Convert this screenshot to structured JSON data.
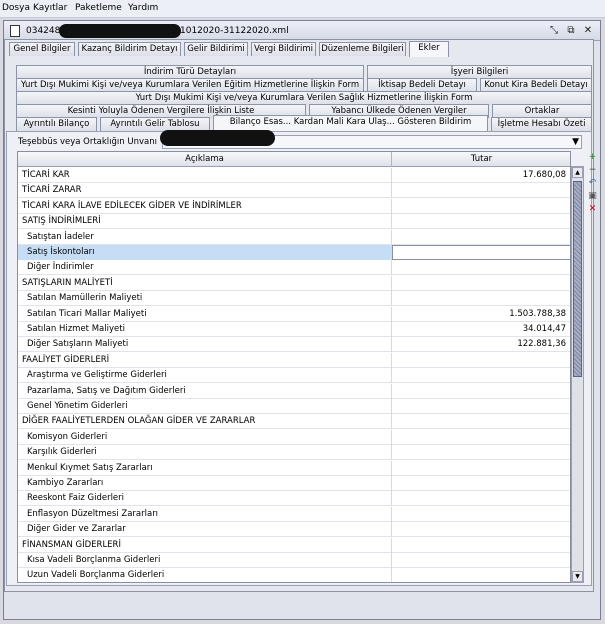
{
  "menu": [
    "Dosya",
    "Kayıtlar",
    "Paketleme",
    "Yardım"
  ],
  "window": {
    "title_prefix": "034248",
    "title_suffix": "1012020-31122020.xml",
    "btn_restore": "⤡",
    "btn_maximize": "⧉",
    "btn_close": "✕"
  },
  "tabs_top": [
    "Genel Bilgiler",
    "Kazanç Bildirim Detayı",
    "Gelir Bildirimi",
    "Vergi Bildirimi",
    "Düzenleme Bilgileri",
    "Ekler"
  ],
  "ek_tabs": {
    "row1": [
      "İndirim Türü Detayları",
      "İşyeri Bilgileri"
    ],
    "row2": [
      "Yurt Dışı Mukimi Kişi ve/veya Kurumlara Verilen Eğitim Hizmetlerine İlişkin Form",
      "İktisap Bedeli Detayı",
      "Konut Kira Bedeli Detayı"
    ],
    "row3": [
      "Yurt Dışı Mukimi Kişi ve/veya Kurumlara Verilen Sağlık Hizmetlerine İlişkin Form"
    ],
    "row4": [
      "Kesinti Yoluyla Ödenen Vergilere İlişkin Liste",
      "Yabancı Ülkede Ödenen Vergiler",
      "Ortaklar"
    ],
    "row5": [
      "Ayrıntılı Bilanço",
      "Ayrıntılı Gelir Tablosu",
      "Bilanço Esas... Kardan Mali Kara Ulaş... Gösteren Bildirim",
      "İşletme Hesabı Özeti"
    ]
  },
  "firm": {
    "label": "Teşebbüs veya Ortaklığın Unvanı",
    "dropdown_icon": "▼"
  },
  "grid": {
    "headers": [
      "Açıklama",
      "Tutar"
    ],
    "rows": [
      {
        "label": "TİCARİ KAR",
        "value": "17.680,08",
        "indent": false
      },
      {
        "label": "TİCARİ ZARAR",
        "value": "",
        "indent": false
      },
      {
        "label": "TİCARİ KARA İLAVE EDİLECEK GİDER VE İNDİRİMLER",
        "value": "",
        "indent": false
      },
      {
        "label": "SATIŞ İNDİRİMLERİ",
        "value": "",
        "indent": false
      },
      {
        "label": "Satıştan İadeler",
        "value": "",
        "indent": true
      },
      {
        "label": "Satış İskontoları",
        "value": "",
        "indent": true,
        "selected": true
      },
      {
        "label": "Diğer İndirimler",
        "value": "",
        "indent": true
      },
      {
        "label": "SATIŞLARIN MALİYETİ",
        "value": "",
        "indent": false
      },
      {
        "label": "Satılan Mamüllerin Maliyeti",
        "value": "",
        "indent": true
      },
      {
        "label": "Satılan Ticari Mallar Maliyeti",
        "value": "1.503.788,38",
        "indent": true
      },
      {
        "label": "Satılan Hizmet Maliyeti",
        "value": "34.014,47",
        "indent": true
      },
      {
        "label": "Diğer Satışların Maliyeti",
        "value": "122.881,36",
        "indent": true
      },
      {
        "label": "FAALİYET GİDERLERİ",
        "value": "",
        "indent": false
      },
      {
        "label": "Araştırma ve Geliştirme Giderleri",
        "value": "",
        "indent": true
      },
      {
        "label": "Pazarlama, Satış ve Dağıtım Giderleri",
        "value": "",
        "indent": true
      },
      {
        "label": "Genel Yönetim Giderleri",
        "value": "",
        "indent": true
      },
      {
        "label": "DİĞER FAALİYETLERDEN OLAĞAN GİDER VE ZARARLAR",
        "value": "",
        "indent": false
      },
      {
        "label": "Komisyon Giderleri",
        "value": "",
        "indent": true
      },
      {
        "label": "Karşılık Giderleri",
        "value": "",
        "indent": true
      },
      {
        "label": "Menkul Kıymet Satış Zararları",
        "value": "",
        "indent": true
      },
      {
        "label": "Kambiyo Zararları",
        "value": "",
        "indent": true
      },
      {
        "label": "Reeskont Faiz Giderleri",
        "value": "",
        "indent": true
      },
      {
        "label": "Enflasyon Düzeltmesi Zararları",
        "value": "",
        "indent": true
      },
      {
        "label": "Diğer Gider ve Zararlar",
        "value": "",
        "indent": true
      },
      {
        "label": "FİNANSMAN GİDERLERİ",
        "value": "",
        "indent": false
      },
      {
        "label": "Kısa Vadeli Borçlanma Giderleri",
        "value": "",
        "indent": true
      },
      {
        "label": "Uzun Vadeli Borçlanma Giderleri",
        "value": "",
        "indent": true
      }
    ]
  },
  "side_tools": {
    "add": "+",
    "remove": "−",
    "undo": "↶",
    "copy": "▣",
    "delete": "✕"
  },
  "scroll": {
    "up": "▲",
    "down": "▼"
  },
  "colors": {
    "selection": "#c6def5",
    "delete": "#cc0000",
    "add": "#2f8a2f"
  }
}
